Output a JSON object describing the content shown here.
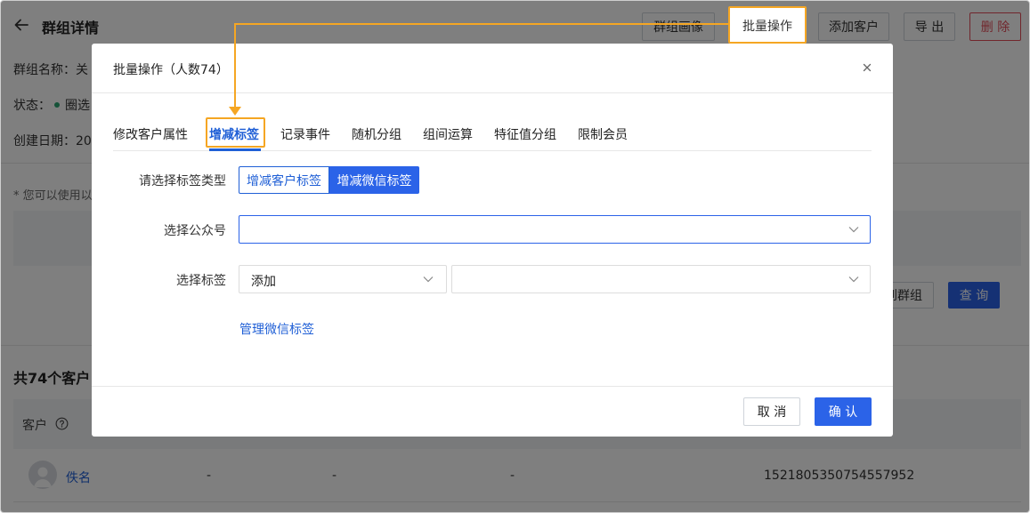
{
  "header": {
    "title": "群组详情",
    "buttons": {
      "portrait": "群组画像",
      "batch": "批量操作",
      "add_customer": "添加客户",
      "export": "导 出",
      "delete": "删 除"
    }
  },
  "info": {
    "name_label": "群组名称：关",
    "status_label": "状态：",
    "status_value": "圈选",
    "created_label": "创建日期：20"
  },
  "tip": "* 您可以使用以",
  "bg_buttons": {
    "group_partial": "到群组",
    "query": "查 询"
  },
  "list": {
    "count_text": "共74个客户",
    "column_customer": "客户",
    "rows": [
      {
        "name": "佚名",
        "c1": "-",
        "c2": "-",
        "c3": "-",
        "id": "1521805350754557952"
      }
    ]
  },
  "modal": {
    "title": "批量操作（人数74）",
    "tabs": [
      "修改客户属性",
      "增减标签",
      "记录事件",
      "随机分组",
      "组间运算",
      "特征值分组",
      "限制会员"
    ],
    "active_tab": "增减标签",
    "form": {
      "tag_type_label": "请选择标签类型",
      "tag_type_options": [
        "增减客户标签",
        "增减微信标签"
      ],
      "tag_type_selected": "增减微信标签",
      "account_label": "选择公众号",
      "account_value": "",
      "tag_label": "选择标签",
      "tag_action_value": "添加",
      "tag_value": "",
      "manage_link": "管理微信标签"
    },
    "footer": {
      "cancel": "取 消",
      "confirm": "确 认"
    }
  },
  "colors": {
    "primary": "#2b63e8",
    "danger": "#e34d59",
    "annotation": "#f5a623",
    "success_dot": "#2ba471"
  },
  "icons": [
    "back-arrow-icon",
    "close-icon",
    "chevron-down-icon",
    "help-circle-icon",
    "user-avatar-icon"
  ]
}
